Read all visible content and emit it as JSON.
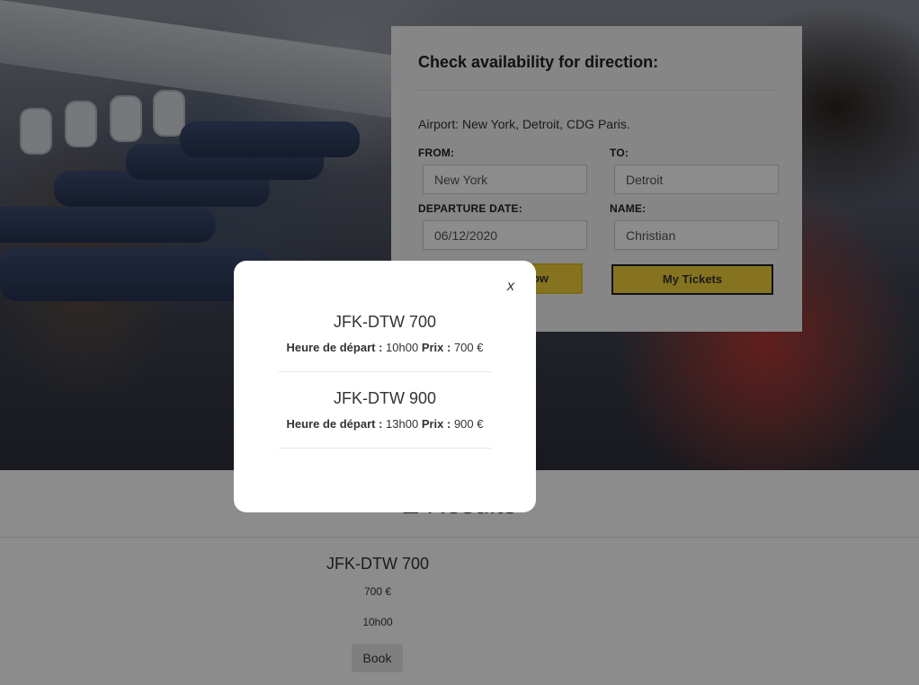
{
  "booking": {
    "title": "Check availability for direction:",
    "airports": "Airport: New York, Detroit, CDG Paris.",
    "from_label": "FROM:",
    "from_value": "New York",
    "to_label": "TO:",
    "to_value": "Detroit",
    "date_label": "DEPARTURE DATE:",
    "date_value": "06/12/2020",
    "name_label": "NAME:",
    "name_value": "Christian",
    "search_button": "ow",
    "tickets_button": "My Tickets"
  },
  "results": {
    "title": "Z Results",
    "flight": {
      "name": "JFK-DTW 700",
      "price": "700 €",
      "time": "10h00",
      "book_label": "Book"
    }
  },
  "modal": {
    "close_label": "x",
    "departure_label": "Heure de départ :",
    "price_label": "Prix :",
    "offers": [
      {
        "name": "JFK-DTW 700",
        "time": "10h00",
        "price": "700 €"
      },
      {
        "name": "JFK-DTW 900",
        "time": "13h00",
        "price": "900 €"
      }
    ]
  },
  "colors": {
    "accent": "#f2d13a",
    "overlay": "rgba(0,0,0,0.45)"
  }
}
